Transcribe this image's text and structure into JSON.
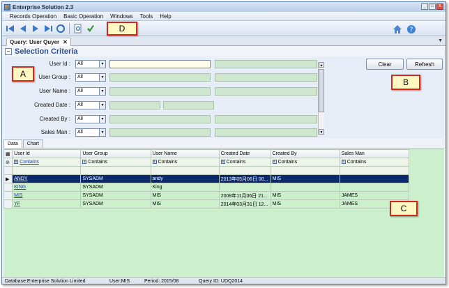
{
  "window": {
    "title": "Enterprise Solution  2.3",
    "controls": [
      "_",
      "□",
      "X"
    ]
  },
  "menu": [
    "Records Operation",
    "Basic Operation",
    "Windows",
    "Tools",
    "Help"
  ],
  "toolbar": {
    "icons": [
      "first-record-icon",
      "previous-record-icon",
      "next-record-icon",
      "last-record-icon",
      "refresh-icon",
      "find-icon",
      "export-icon"
    ],
    "right_icons": [
      "home-icon",
      "help-icon"
    ]
  },
  "callouts": {
    "a": "A",
    "b": "B",
    "c": "C",
    "d": "D"
  },
  "doc_tab": {
    "label": "Query: User Quyer",
    "close": "✕",
    "arrow": "▼"
  },
  "criteria": {
    "title": "Selection Criteria",
    "collapse": "−",
    "rows": [
      {
        "label": "User Id :",
        "op": "All"
      },
      {
        "label": "User Group :",
        "op": "All"
      },
      {
        "label": "User Name :",
        "op": "All"
      },
      {
        "label": "Created Date :",
        "op": "All"
      },
      {
        "label": "Created By :",
        "op": "All"
      },
      {
        "label": "Sales Man :",
        "op": "All"
      }
    ],
    "buttons": {
      "clear": "Clear",
      "refresh": "Refresh"
    }
  },
  "subtabs": [
    "Data",
    "Chart"
  ],
  "grid": {
    "columns": [
      "User Id",
      "User Group",
      "User Name",
      "Created Date",
      "Created By",
      "Sales Man"
    ],
    "filter": [
      "Contains",
      "Contains",
      "Contains",
      "Contains",
      "Contains",
      "Contains"
    ],
    "rows": [
      [
        "ANDY",
        "SYSADM",
        "andy",
        "2013年05月06日 00...",
        "MIS",
        ""
      ],
      [
        "KING",
        "SYSADM",
        "King",
        "",
        "",
        ""
      ],
      [
        "MIS",
        "SYSADM",
        "MIS",
        "2008年11月06日 21...",
        "MIS",
        "JAMES"
      ],
      [
        "YF",
        "SYSADM",
        "MIS",
        "2014年03月31日 12...",
        "MIS",
        "JAMES"
      ]
    ],
    "selected_row": 0,
    "row_marker": "▶"
  },
  "status": {
    "database": "Database:Enterprise Solution Limited",
    "user": "User:MIS",
    "period": "Period: 2015/08",
    "query_id": "Query ID:  UDQ2014"
  }
}
